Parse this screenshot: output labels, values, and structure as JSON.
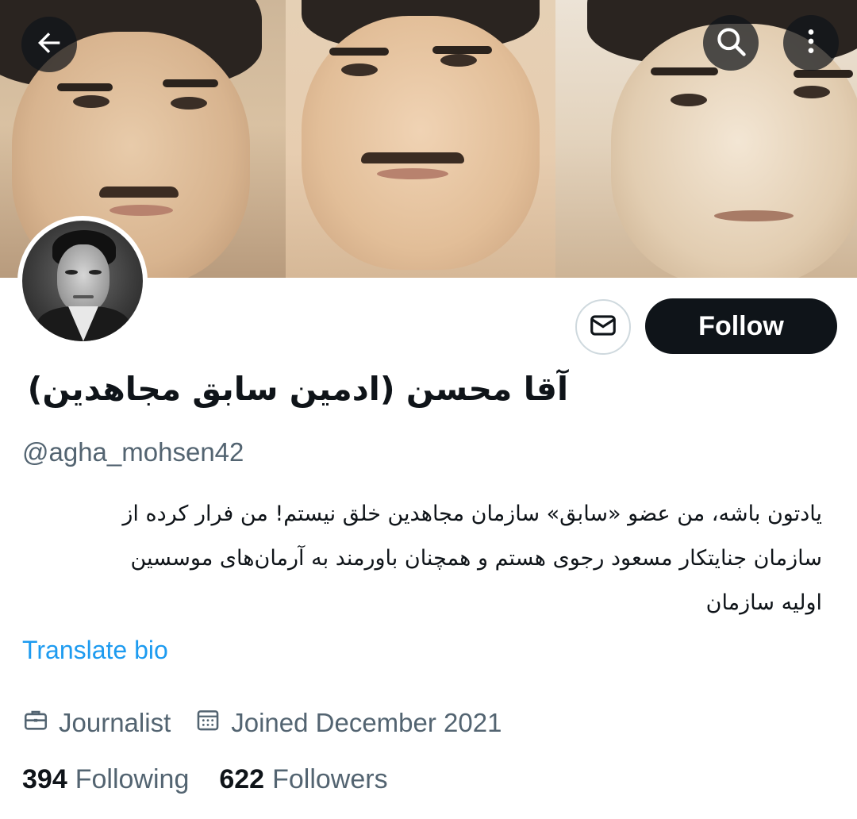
{
  "header": {
    "back_icon": "arrow-left-icon",
    "search_icon": "search-icon",
    "more_icon": "more-vertical-icon"
  },
  "profile": {
    "name": "آقا محسن (ادمین سابق مجاهدین)",
    "handle": "@agha_mohsen42",
    "bio_lines": [
      "یادتون باشه، من عضو «سابق» سازمان مجاهدین خلق نیستم! من فرار کرده از",
      "سازمان جنایتکار مسعود رجوی هستم و همچنان باورمند به آرمان‌های موسسین",
      "اولیه سازمان"
    ],
    "translate_label": "Translate bio",
    "profession": "Journalist",
    "joined": "Joined December 2021",
    "following_count": "394",
    "following_label": "Following",
    "followers_count": "622",
    "followers_label": "Followers"
  },
  "actions": {
    "follow_label": "Follow",
    "message_icon": "envelope-icon"
  },
  "colors": {
    "accent_link": "#1d9bf0",
    "primary_button": "#0f1419",
    "secondary_text": "#536471"
  }
}
